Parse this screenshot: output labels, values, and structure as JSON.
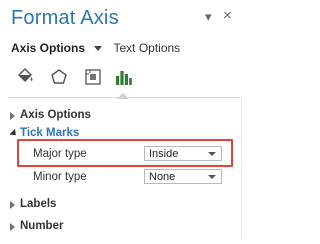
{
  "pane": {
    "title": "Format Axis",
    "close_glyph": "×",
    "pin_glyph": "▾"
  },
  "tabs": {
    "active_label": "Axis Options",
    "other_label": "Text Options"
  },
  "icons": [
    {
      "name": "fill-line-icon"
    },
    {
      "name": "effects-icon"
    },
    {
      "name": "size-properties-icon"
    },
    {
      "name": "axis-options-icon",
      "active": true
    }
  ],
  "sections": {
    "axis_options": "Axis Options",
    "tick_marks": "Tick Marks",
    "labels": "Labels",
    "number": "Number"
  },
  "tick_marks": {
    "major_type_label": "Major type",
    "major_type_value": "Inside",
    "minor_type_label": "Minor type",
    "minor_type_value": "None"
  },
  "colors": {
    "accent": "#2e75b6",
    "highlight": "#e0443e",
    "active_icon": "#2f7d32"
  }
}
